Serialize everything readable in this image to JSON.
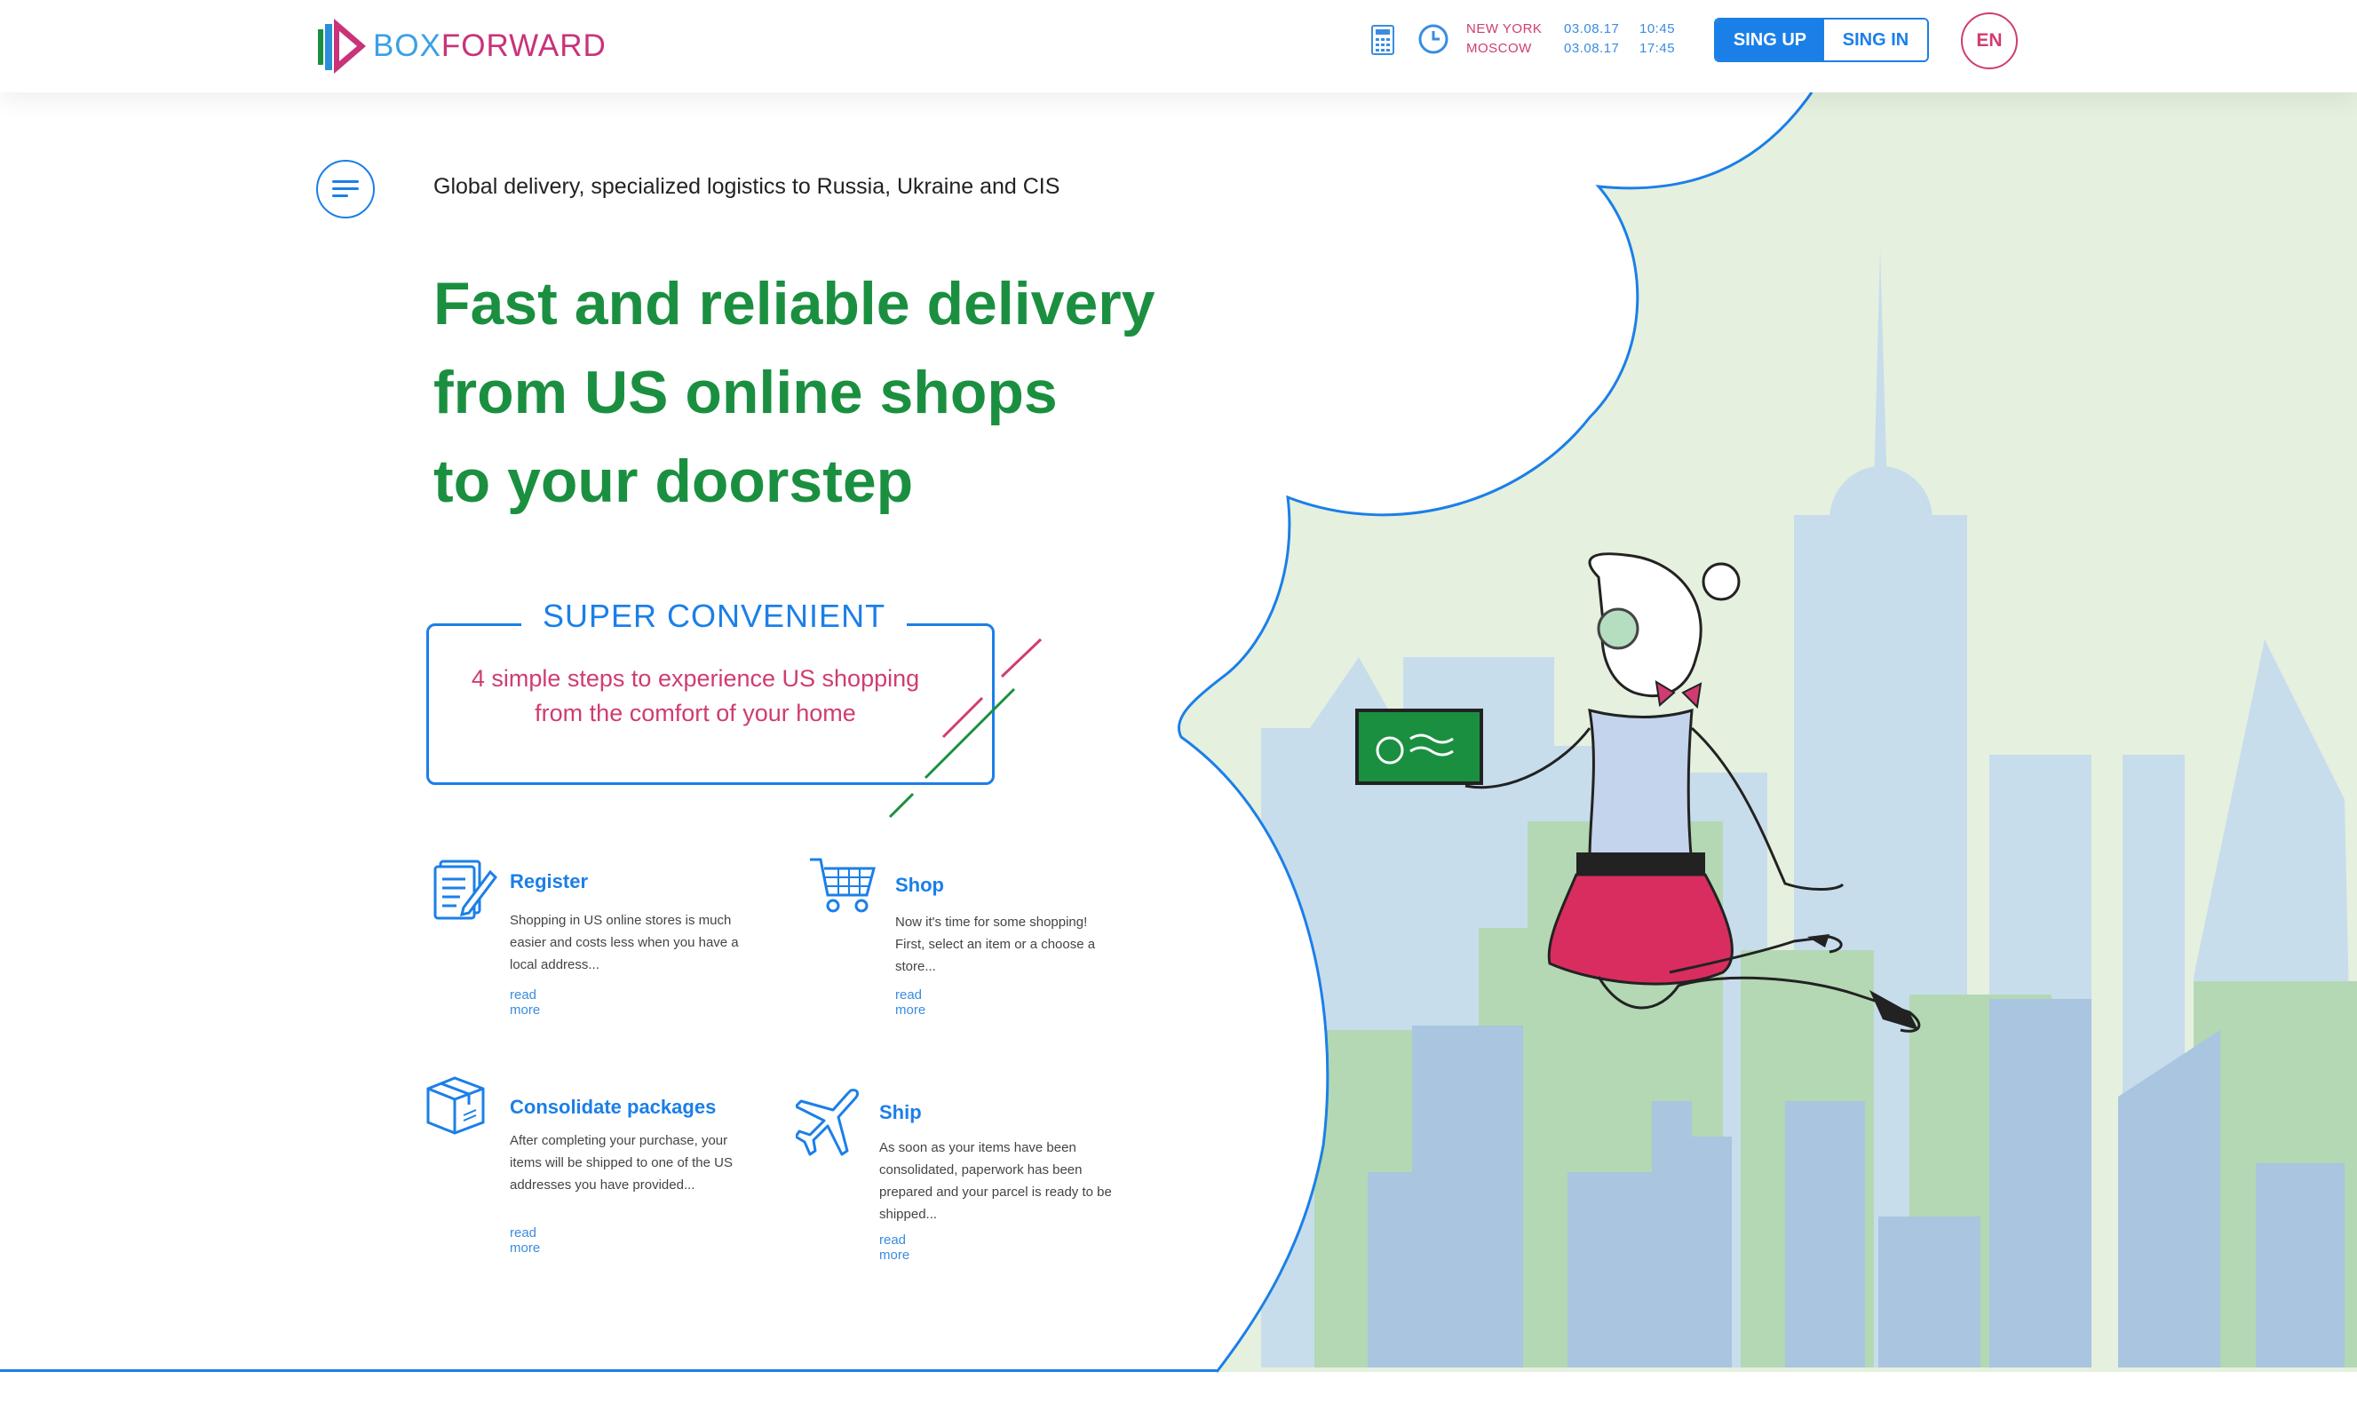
{
  "brand": {
    "name_part1": "BOX",
    "name_part2": "FORWARD"
  },
  "header": {
    "calculator_icon": "calculator-icon",
    "clock_icon": "clock-icon",
    "timezones": [
      {
        "city": "NEW YORK",
        "date": "03.08.17",
        "time": "10:45"
      },
      {
        "city": "MOSCOW",
        "date": "03.08.17",
        "time": "17:45"
      }
    ],
    "signup_label": "SING UP",
    "signin_label": "SING IN",
    "language": "EN"
  },
  "hero": {
    "tagline": "Global delivery, specialized logistics to Russia, Ukraine and CIS",
    "headline_lines": [
      "Fast and reliable delivery",
      "from US online shops",
      "to your doorstep"
    ]
  },
  "steps_box": {
    "title": "SUPER CONVENIENT",
    "text": "4 simple steps to experience US shopping from the comfort of your home"
  },
  "steps": [
    {
      "icon": "register-icon",
      "title": "Register",
      "description": "Shopping in US online stores is much easier and costs less when you have a local address...",
      "link": "read more"
    },
    {
      "icon": "shopping-cart-icon",
      "title": "Shop",
      "description": "Now it's time for some shopping! First, select an item or a choose a store...",
      "link": "read more"
    },
    {
      "icon": "package-icon",
      "title": "Consolidate packages",
      "description": "After completing your purchase, your items will be shipped to one of the US addresses you have provided...",
      "link": "read more"
    },
    {
      "icon": "airplane-icon",
      "title": "Ship",
      "description": "As soon as your items have been consolidated, paperwork has been prepared and your parcel is ready to be shipped...",
      "link": "read more"
    }
  ],
  "colors": {
    "brand_blue": "#1b7fe8",
    "brand_pink": "#d03c72",
    "headline_green": "#1b8f40"
  }
}
